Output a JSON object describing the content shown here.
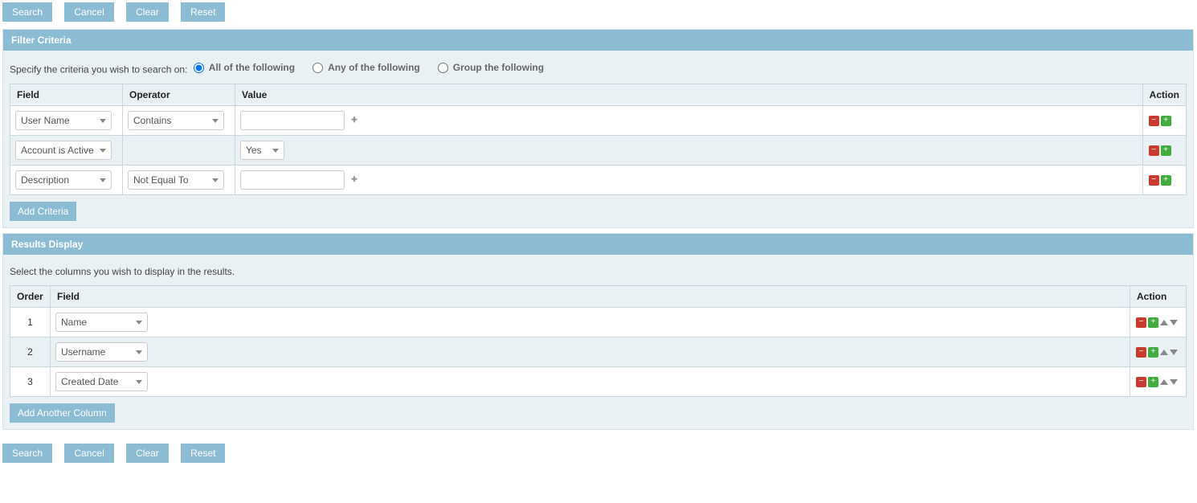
{
  "buttons": {
    "search": "Search",
    "cancel": "Cancel",
    "clear": "Clear",
    "reset": "Reset"
  },
  "filter": {
    "title": "Filter Criteria",
    "instruct": "Specify the criteria you wish to search on:",
    "radios": {
      "all": "All of the following",
      "any": "Any of the following",
      "group": "Group the following"
    },
    "headers": {
      "field": "Field",
      "operator": "Operator",
      "value": "Value",
      "action": "Action"
    },
    "rows": [
      {
        "field": "User Name",
        "operator": "Contains",
        "value": "",
        "value_type": "text"
      },
      {
        "field": "Account is Active",
        "operator": "",
        "value": "Yes",
        "value_type": "select"
      },
      {
        "field": "Description",
        "operator": "Not Equal To",
        "value": "",
        "value_type": "text"
      }
    ],
    "add_label": "Add Criteria"
  },
  "results": {
    "title": "Results Display",
    "instruct": "Select the columns you wish to display in the results.",
    "headers": {
      "order": "Order",
      "field": "Field",
      "action": "Action"
    },
    "rows": [
      {
        "order": "1",
        "field": "Name"
      },
      {
        "order": "2",
        "field": "Username"
      },
      {
        "order": "3",
        "field": "Created Date"
      }
    ],
    "add_label": "Add Another Column"
  }
}
